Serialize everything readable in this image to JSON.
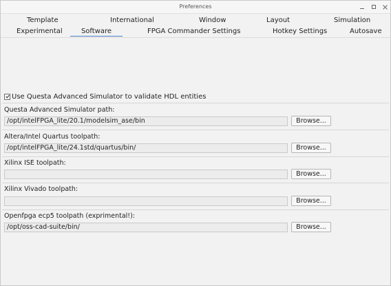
{
  "window": {
    "title": "Preferences"
  },
  "tabs": {
    "row1": [
      "Template",
      "International",
      "Window",
      "Layout",
      "Simulation"
    ],
    "row2": [
      "Experimental",
      "Software",
      "FPGA Commander Settings",
      "Hotkey Settings",
      "Autosave"
    ],
    "active": "Software"
  },
  "software": {
    "validate_checkbox": {
      "label": "Use Questa Advanced Simulator to validate HDL entities",
      "checked": true
    },
    "fields": [
      {
        "label": "Questa Advanced Simulator path:",
        "value": "/opt/intelFPGA_lite/20.1/modelsim_ase/bin"
      },
      {
        "label": "Altera/Intel Quartus toolpath:",
        "value": "/opt/intelFPGA_lite/24.1std/quartus/bin/"
      },
      {
        "label": "Xilinx ISE toolpath:",
        "value": ""
      },
      {
        "label": "Xilinx Vivado toolpath:",
        "value": ""
      },
      {
        "label": "Openfpga ecp5 toolpath (exprimental!):",
        "value": "/opt/oss-cad-suite/bin/"
      }
    ],
    "browse_label": "Browse..."
  }
}
